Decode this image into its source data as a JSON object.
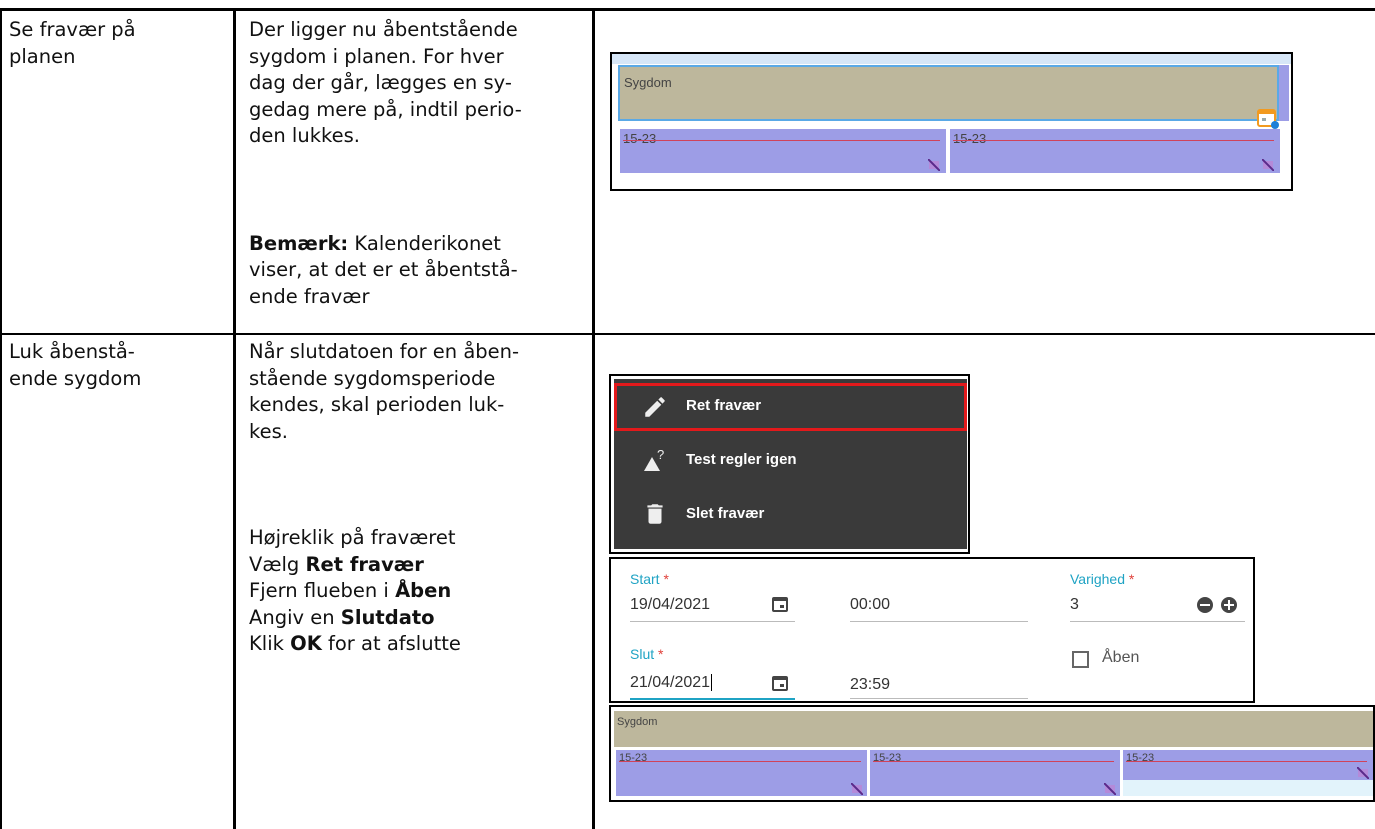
{
  "rows": [
    {
      "label": "Se fravær på\nplanen",
      "description": "Der ligger nu åbentstående\nsygdom i planen. For hver\ndag der går, lægges en sy-\ngedag mere på, indtil perio-\nden lukkes.",
      "note_bold": "Bemærk:",
      "note_text_1": " Kalenderikonet",
      "note_text_2": "viser, at det er et åbentstå-\nende fravær"
    },
    {
      "label": "Luk åbenstå-\nende sygdom",
      "description": "Når slutdatoen for en åben-\nstående sygdomsperiode\nkendes, skal perioden luk-\nkes.",
      "steps": {
        "s1": "Højreklik på fraværet",
        "s2_pre": "Vælg ",
        "s2_bold": "Ret fravær",
        "s3_pre": "Fjern flueben i ",
        "s3_bold": "Åben",
        "s4_pre": "Angiv en ",
        "s4_bold": "Slutdato",
        "s5_pre": "Klik ",
        "s5_bold": "OK",
        "s5_post": " for at afslutte"
      }
    }
  ],
  "plan1": {
    "absence_label": "Sygdom",
    "shifts": [
      "15-23",
      "15-23"
    ]
  },
  "context_menu": {
    "items": [
      {
        "label": "Ret fravær",
        "icon": "pencil-icon"
      },
      {
        "label": "Test regler igen",
        "icon": "warning-question-icon"
      },
      {
        "label": "Slet fravær",
        "icon": "trash-icon"
      }
    ],
    "highlight_color": "#e3191b"
  },
  "edit_form": {
    "start_label": "Start",
    "start_date": "19/04/2021",
    "start_time": "00:00",
    "duration_label": "Varighed",
    "duration_value": "3",
    "end_label": "Slut",
    "end_date": "21/04/2021",
    "end_time": "23:59",
    "open_label": "Åben",
    "required_mark": "*",
    "accent_color": "#1fa3c4"
  },
  "plan2": {
    "absence_label": "Sygdom",
    "shifts": [
      "15-23",
      "15-23",
      "15-23"
    ]
  }
}
